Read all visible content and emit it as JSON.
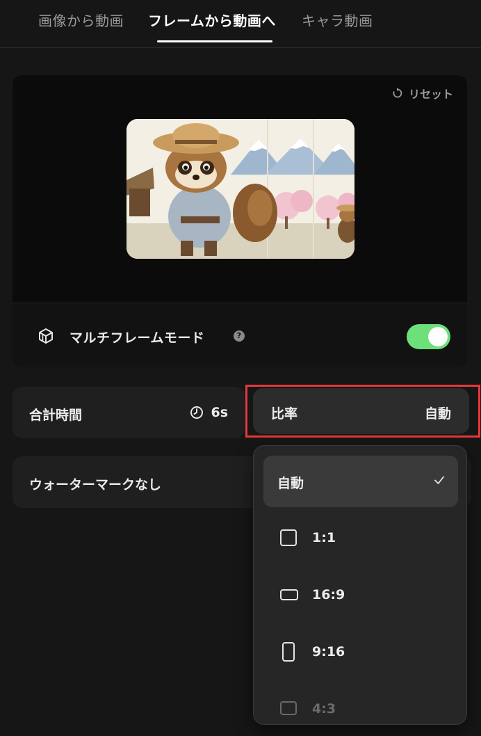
{
  "tabs": [
    {
      "label": "画像から動画",
      "active": false
    },
    {
      "label": "フレームから動画へ",
      "active": true
    },
    {
      "label": "キャラ動画",
      "active": false
    }
  ],
  "preview": {
    "reset_label": "リセット",
    "multi_frame_label": "マルチフレームモード",
    "help_glyph": "?",
    "multi_frame_enabled": true
  },
  "settings": {
    "duration_label": "合計時間",
    "duration_value": "6s",
    "ratio_label": "比率",
    "ratio_value": "自動",
    "watermark_label": "ウォーターマークなし"
  },
  "ratio_options": [
    {
      "label": "自動",
      "selected": true
    },
    {
      "label": "1:1",
      "selected": false
    },
    {
      "label": "16:9",
      "selected": false
    },
    {
      "label": "9:16",
      "selected": false
    },
    {
      "label": "4:3",
      "selected": false
    }
  ],
  "colors": {
    "background": "#161616",
    "toggle_on": "#6ee07a",
    "highlight_border": "#e5383b"
  },
  "icons": [
    "reset-icon",
    "multi-frame-icon",
    "help-icon",
    "clock-icon",
    "check-icon"
  ]
}
